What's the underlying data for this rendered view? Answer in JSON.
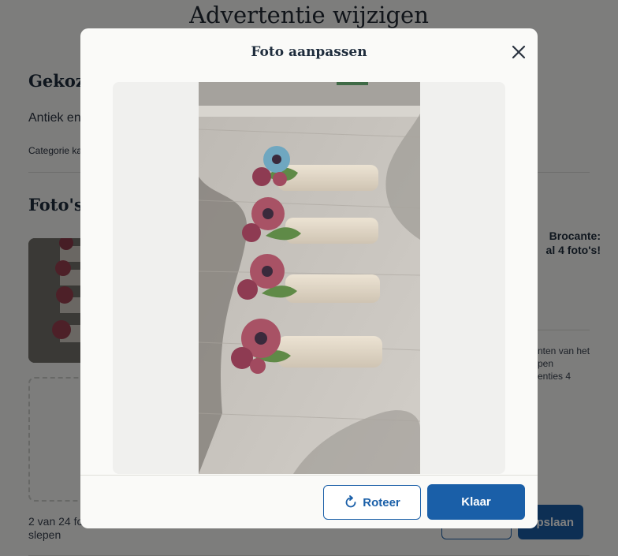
{
  "page": {
    "title": "Advertentie wijzigen",
    "chosen_heading": "Gekoze",
    "category_path": "Antiek en",
    "category_change": "Categorie ka",
    "photos_heading": "Foto's",
    "photo_count": "2 van 24 fo",
    "photo_hint": "slepen",
    "promo_title_1": "Brocante:",
    "promo_title_2": "al 4 foto's!",
    "promo_body_1": "nten van het",
    "promo_body_2": "pen",
    "promo_body_3": "enties 4",
    "save_label": "pslaan"
  },
  "modal": {
    "title": "Foto aanpassen",
    "close_icon": "close-icon",
    "rotate_icon": "rotate-icon",
    "rotate_label": "Roteer",
    "done_label": "Klaar"
  },
  "colors": {
    "primary": "#1a5fa8",
    "overlay": "rgba(0,0,0,0.5)",
    "modal_bg": "#fafaf8"
  }
}
